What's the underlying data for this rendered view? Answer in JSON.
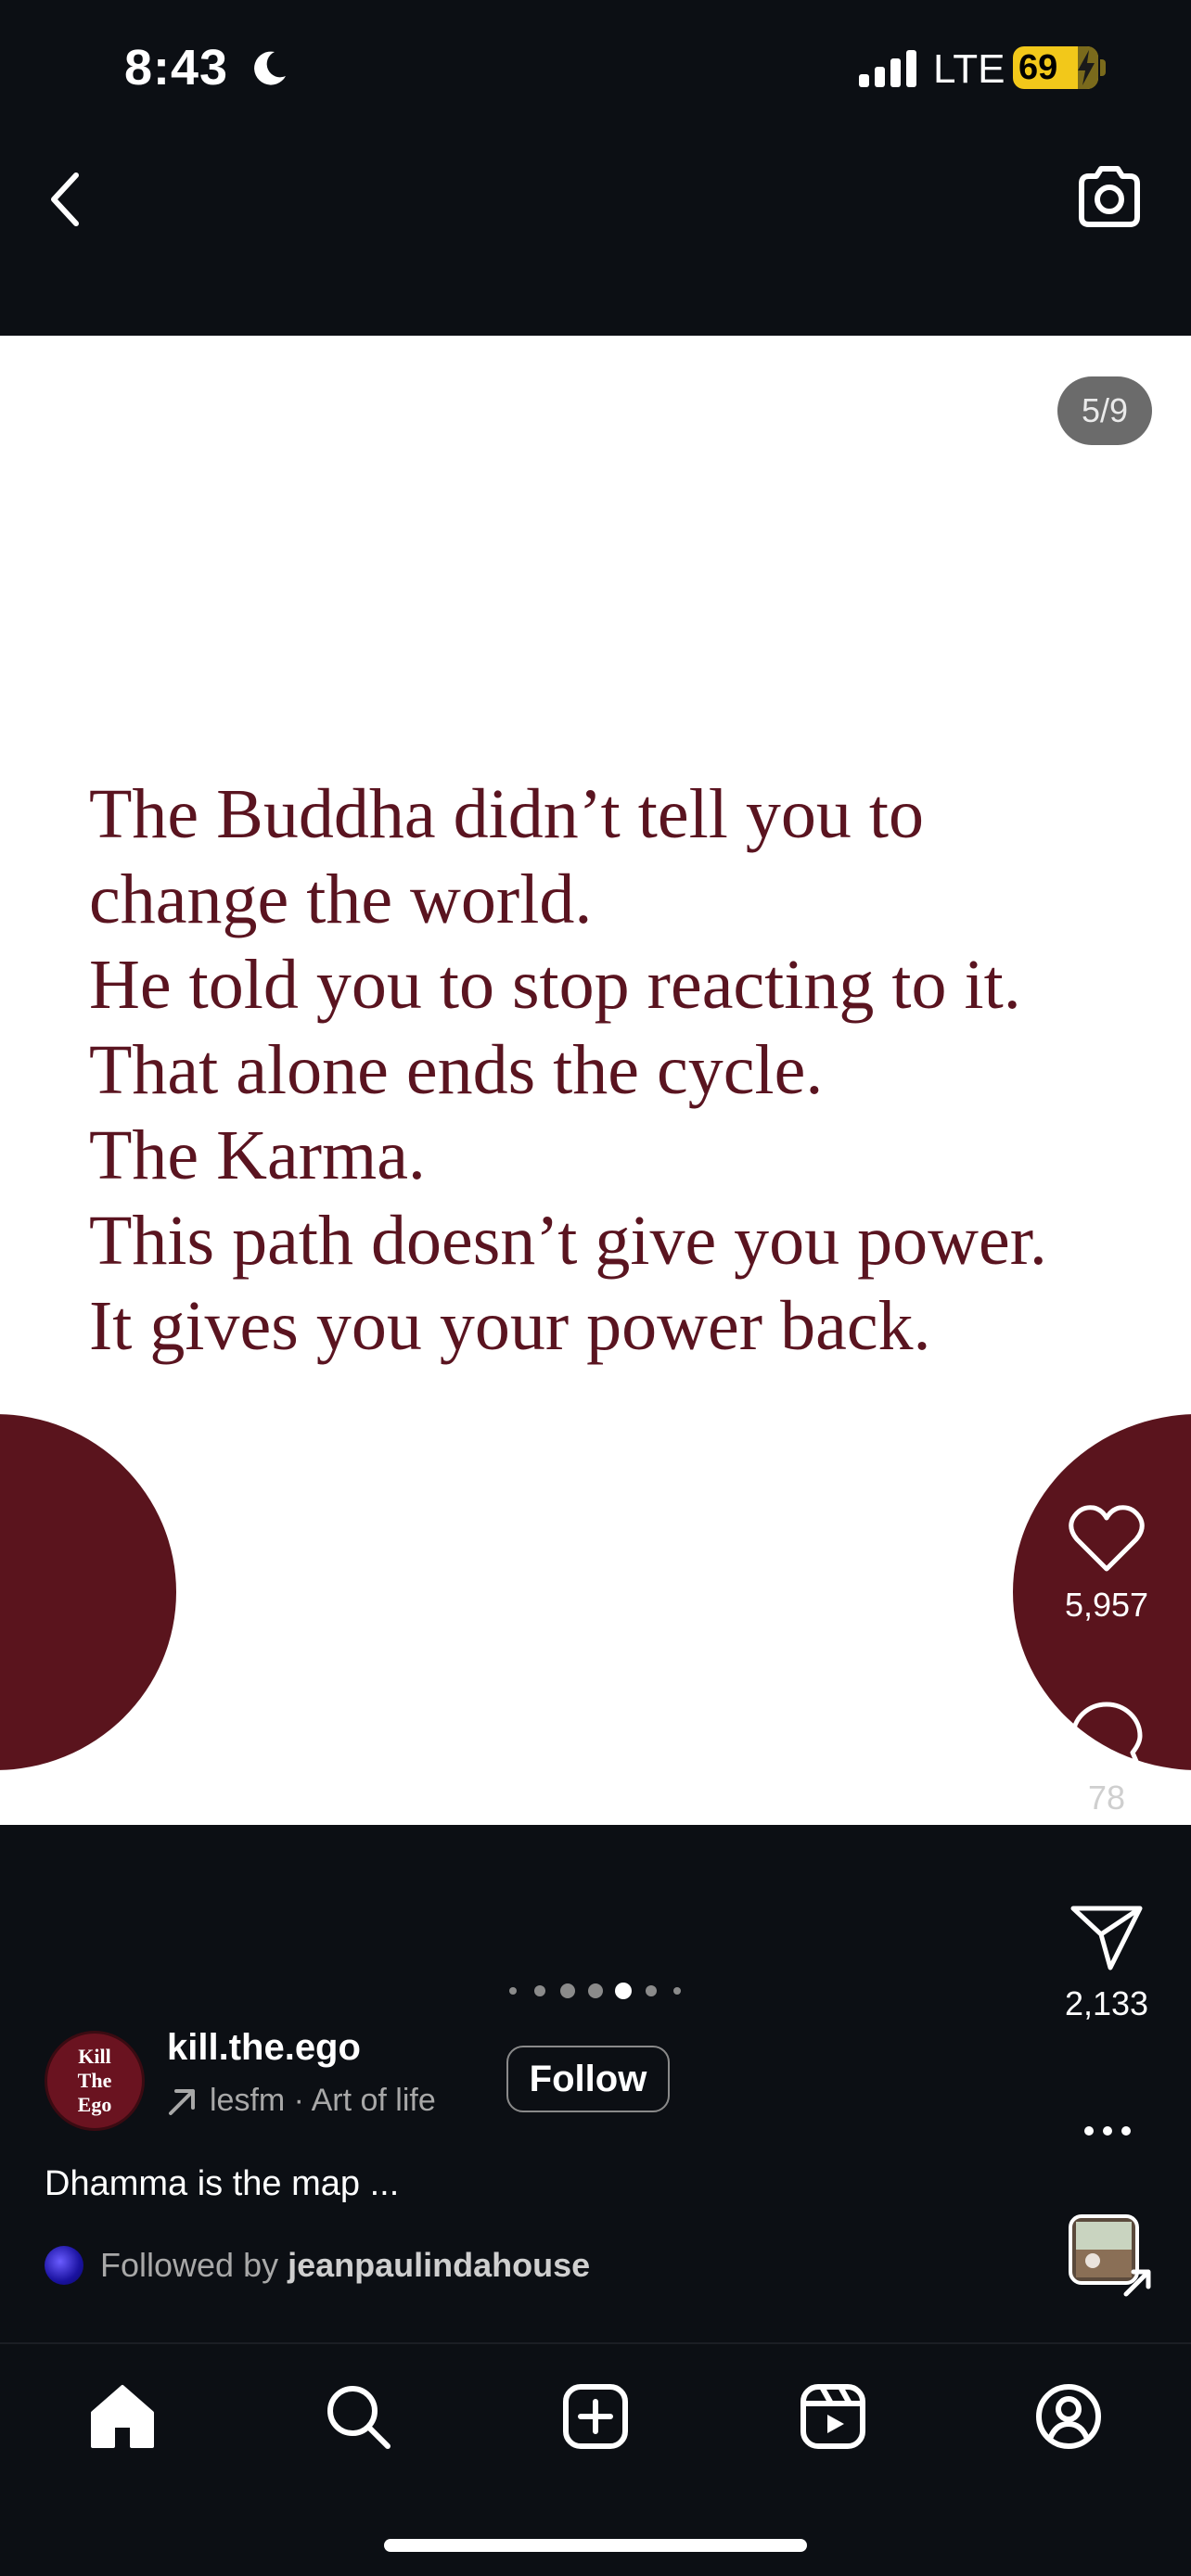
{
  "status_bar": {
    "time": "8:43",
    "network": "LTE",
    "battery": "69"
  },
  "post": {
    "slide_counter": "5/9",
    "quote_lines": [
      "The Buddha didn’t tell you to",
      "change the world.",
      "He told you to stop reacting to it.",
      "That alone ends the cycle.",
      "The Karma.",
      "This path doesn’t give you power.",
      "It gives you your power back."
    ],
    "text_color": "#5a1420",
    "accent_color": "#5a141d"
  },
  "actions": {
    "likes": "5,957",
    "comments": "78",
    "shares": "2,133"
  },
  "author": {
    "avatar_lines": [
      "Kill",
      "The",
      "Ego"
    ],
    "username": "kill.the.ego",
    "audio": "lesfm · Art of life",
    "follow_label": "Follow"
  },
  "caption": "Dhamma is the map ...",
  "followed_by": {
    "prefix": "Followed by",
    "name": "jeanpaulindahouse"
  },
  "carousel": {
    "current": 5,
    "total": 9
  },
  "nav": [
    "home-icon",
    "search-icon",
    "create-icon",
    "reels-icon",
    "profile-icon"
  ]
}
